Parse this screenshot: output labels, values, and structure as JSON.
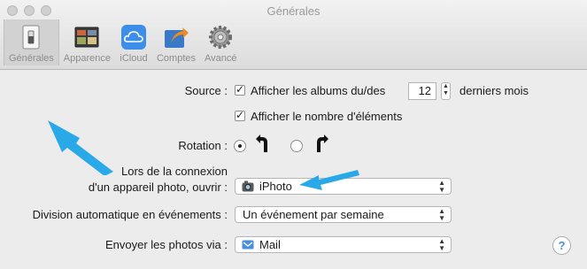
{
  "window": {
    "title": "Générales"
  },
  "tabs": [
    {
      "label": "Générales",
      "icon": "switch-icon",
      "active": true
    },
    {
      "label": "Apparence",
      "icon": "appearance-icon",
      "active": false
    },
    {
      "label": "iCloud",
      "icon": "icloud-icon",
      "active": false
    },
    {
      "label": "Comptes",
      "icon": "accounts-icon",
      "active": false
    },
    {
      "label": "Avancé",
      "icon": "gear-icon",
      "active": false
    }
  ],
  "source": {
    "label": "Source :",
    "show_albums_label": "Afficher les albums du/des",
    "months_value": "12",
    "months_suffix": "derniers mois",
    "show_count_label": "Afficher le nombre d'éléments",
    "show_albums_checked": true,
    "show_count_checked": true
  },
  "rotation": {
    "label": "Rotation :",
    "selected": "counterclockwise"
  },
  "connection": {
    "label_line1": "Lors de la connexion",
    "label_line2": "d'un appareil photo, ouvrir :",
    "value": "iPhoto"
  },
  "auto_split": {
    "label": "Division automatique en événements :",
    "value": "Un événement par semaine"
  },
  "send_photos": {
    "label": "Envoyer les photos via :",
    "value": "Mail"
  },
  "help": {
    "label": "?"
  },
  "colors": {
    "accent_arrow": "#29a9e8",
    "help_blue": "#4a90d9"
  }
}
